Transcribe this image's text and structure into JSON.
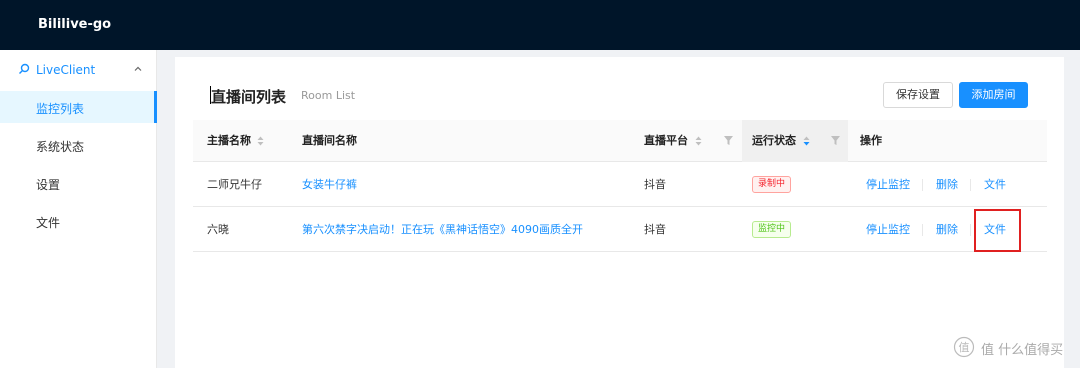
{
  "app": {
    "title": "Bililive-go"
  },
  "sidebar": {
    "group": {
      "label": "LiveClient",
      "icon": "search-icon",
      "expanded": true
    },
    "items": [
      {
        "label": "监控列表",
        "active": true
      },
      {
        "label": "系统状态",
        "active": false
      },
      {
        "label": "设置",
        "active": false
      },
      {
        "label": "文件",
        "active": false
      }
    ]
  },
  "page": {
    "title": "直播间列表",
    "subtitle": "Room List",
    "save_button": "保存设置",
    "add_button": "添加房间"
  },
  "table": {
    "columns": {
      "anchor": "主播名称",
      "room": "直播间名称",
      "platform": "直播平台",
      "status": "运行状态",
      "actions": "操作"
    },
    "rows": [
      {
        "anchor": "二师兄牛仔",
        "room": "女装牛仔裤",
        "platform": "抖音",
        "status": "录制中",
        "status_color": "red",
        "stop": "停止监控",
        "delete": "删除",
        "file": "文件"
      },
      {
        "anchor": "六晓",
        "room": "第六次禁字决启动！正在玩《黑神话悟空》4090画质全开",
        "platform": "抖音",
        "status": "监控中",
        "status_color": "green",
        "stop": "停止监控",
        "delete": "删除",
        "file": "文件"
      }
    ]
  },
  "colors": {
    "header_bg": "#001529",
    "accent": "#1890ff",
    "recording_tag": "#f5222d",
    "monitoring_tag": "#52c41a",
    "highlight": "#e02020"
  },
  "watermark": {
    "text": "值 什么值得买"
  }
}
